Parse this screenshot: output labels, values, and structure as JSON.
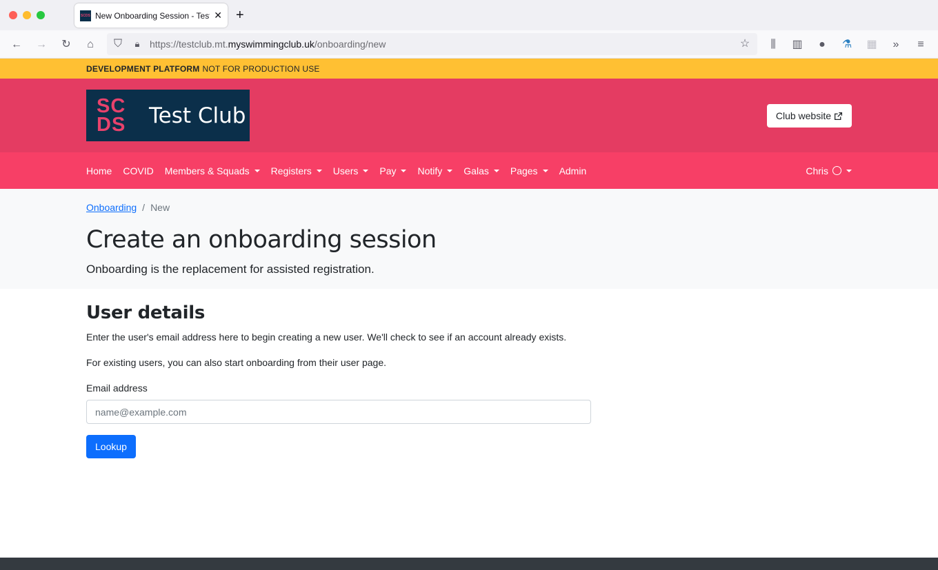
{
  "browser": {
    "tab_title": "New Onboarding Session - Test Club",
    "tab_favicon_text": "SCDS",
    "url_prefix": "https://testclub.mt.",
    "url_host": "myswimmingclub.uk",
    "url_path": "/onboarding/new"
  },
  "banner": {
    "strong": "DEVELOPMENT PLATFORM",
    "text": "NOT FOR PRODUCTION USE"
  },
  "header": {
    "logo_mark": "SC DS",
    "logo_line1": "SC",
    "logo_line2": "DS",
    "club_name": "Test Club",
    "club_website_label": "Club website"
  },
  "nav": {
    "items": [
      {
        "label": "Home",
        "dropdown": false
      },
      {
        "label": "COVID",
        "dropdown": false
      },
      {
        "label": "Members & Squads",
        "dropdown": true
      },
      {
        "label": "Registers",
        "dropdown": true
      },
      {
        "label": "Users",
        "dropdown": true
      },
      {
        "label": "Pay",
        "dropdown": true
      },
      {
        "label": "Notify",
        "dropdown": true
      },
      {
        "label": "Galas",
        "dropdown": true
      },
      {
        "label": "Pages",
        "dropdown": true
      },
      {
        "label": "Admin",
        "dropdown": false
      }
    ],
    "user_name": "Chris"
  },
  "breadcrumb": {
    "parent": "Onboarding",
    "separator": "/",
    "current": "New"
  },
  "hero": {
    "title": "Create an onboarding session",
    "lead": "Onboarding is the replacement for assisted registration."
  },
  "form": {
    "section_title": "User details",
    "paragraph1": "Enter the user's email address here to begin creating a new user. We'll check to see if an account already exists.",
    "paragraph2": "For existing users, you can also start onboarding from their user page.",
    "email_label": "Email address",
    "email_placeholder": "name@example.com",
    "email_value": "",
    "submit_label": "Lookup"
  }
}
